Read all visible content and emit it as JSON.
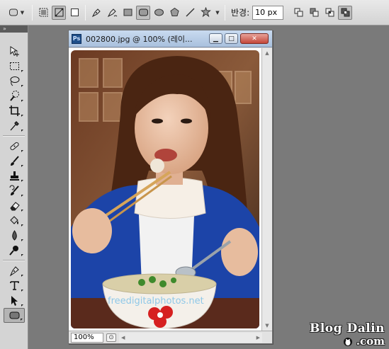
{
  "options_bar": {
    "tool_preset_icon": "rounded-rect-preset-icon",
    "modes": [
      "shape-layers-icon",
      "paths-icon",
      "fill-pixels-icon"
    ],
    "active_mode": "paths-icon",
    "shape_tools": [
      "pen-icon",
      "freeform-pen-icon",
      "rectangle-icon",
      "rounded-rectangle-icon",
      "ellipse-icon",
      "polygon-icon",
      "line-icon",
      "custom-shape-icon"
    ],
    "active_shape": "rounded-rectangle-icon",
    "radius_label": "반경:",
    "radius_value": "10 px",
    "path_ops": [
      "add-icon",
      "subtract-icon",
      "intersect-icon",
      "exclude-icon"
    ],
    "active_path_op": "exclude-icon"
  },
  "toolbox": {
    "header": "»",
    "active_tool": "rounded-rectangle-tool"
  },
  "document": {
    "app_icon": "Ps",
    "title": "002800.jpg @ 100% (레이...",
    "min_label": "▁",
    "max_label": "□",
    "close_label": "✕",
    "zoom_value": "100%",
    "status_icon": "⊙",
    "photo_caption": "freedigitalphotos.net"
  },
  "watermark": {
    "line1": "Blog Dalin",
    "line2": ".com"
  },
  "colors": {
    "workspace": "#7a7a7a",
    "titlebar": "#b8cce6",
    "close_button": "#c4473a"
  }
}
